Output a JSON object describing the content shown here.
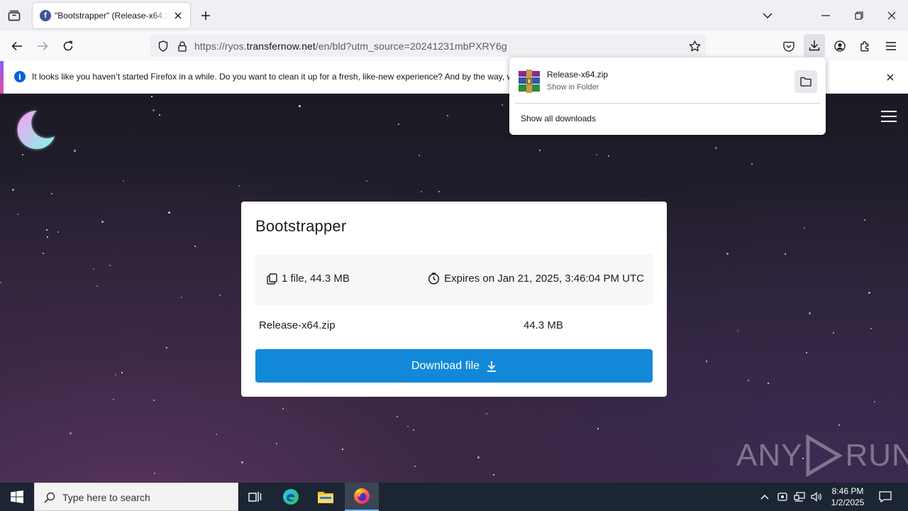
{
  "browser": {
    "tab_title": "\"Bootstrapper\" (Release-x64.zip",
    "tab_favicon": "f",
    "url_prefix": "https://ryos.",
    "url_domain": "transfernow.net",
    "url_path": "/en/bld?utm_source=20241231mbPXRY6g",
    "notification": "It looks like you haven’t started Firefox in a while. Do you want to clean it up for a fresh, like-new experience? And by the way, w"
  },
  "downloads_panel": {
    "file_name": "Release-x64.zip",
    "sub_label": "Show in Folder",
    "show_all": "Show all downloads"
  },
  "card": {
    "title": "Bootstrapper",
    "file_count": "1 file, 44.3 MB",
    "expires": "Expires on Jan 21, 2025, 3:46:04 PM UTC",
    "file_name": "Release-x64.zip",
    "file_size": "44.3 MB",
    "download_label": "Download file"
  },
  "taskbar": {
    "search_placeholder": "Type here to search",
    "time": "8:46 PM",
    "date": "1/2/2025"
  },
  "watermark": "ANY RUN"
}
